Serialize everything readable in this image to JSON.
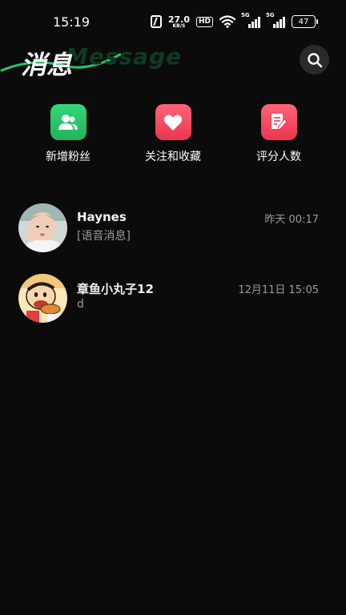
{
  "status_bar": {
    "time": "15:19",
    "net_speed": "27.0",
    "net_speed_unit": "KB/S",
    "hd_label": "HD",
    "signal_1_label": "5G",
    "signal_2_label": "5G",
    "battery": "47",
    "icons": [
      "nfc-icon",
      "hd-icon",
      "wifi-icon",
      "signal-icon",
      "signal-icon",
      "battery-icon"
    ]
  },
  "header": {
    "title": "消息",
    "watermark": "Message",
    "search_icon": "search-icon"
  },
  "quick_actions": [
    {
      "label": "新增粉丝",
      "icon": "users-icon",
      "color": "#2fc46a"
    },
    {
      "label": "关注和收藏",
      "icon": "heart-icon",
      "color": "#f2455e"
    },
    {
      "label": "评分人数",
      "icon": "note-edit-icon",
      "color": "#f2455e"
    }
  ],
  "conversations": [
    {
      "name": "Haynes",
      "preview": "[语音消息]",
      "time": "昨天 00:17",
      "avatar": "baby-photo-avatar"
    },
    {
      "name": "章鱼小丸子12",
      "preview": "d",
      "time": "12月11日 15:05",
      "avatar": "cartoon-avatar"
    }
  ],
  "colors": {
    "background": "#0b0b0b",
    "brand_green": "#2fc46a",
    "brand_red": "#f2455e",
    "secondary_text": "#9a9a9a"
  }
}
